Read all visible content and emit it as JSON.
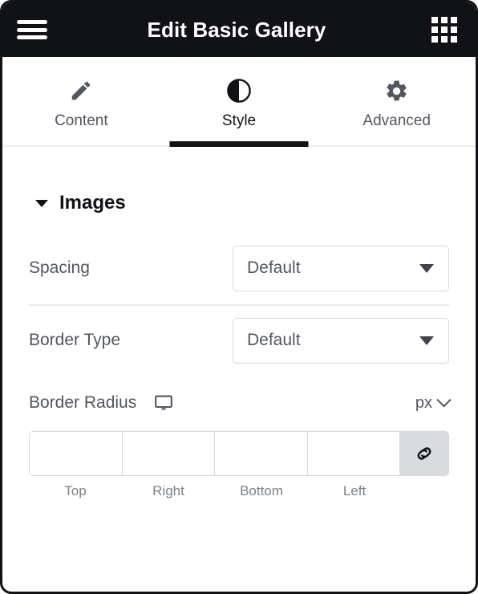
{
  "header": {
    "title": "Edit Basic Gallery",
    "menu_icon": "hamburger-menu-icon",
    "apps_icon": "grid-apps-icon"
  },
  "tabs": [
    {
      "label": "Content",
      "icon": "pencil-icon",
      "active": false
    },
    {
      "label": "Style",
      "icon": "contrast-circle-icon",
      "active": true
    },
    {
      "label": "Advanced",
      "icon": "gear-icon",
      "active": false
    }
  ],
  "section": {
    "title": "Images",
    "expanded": true,
    "toggle_icon": "caret-down-icon"
  },
  "controls": {
    "spacing": {
      "label": "Spacing",
      "value": "Default",
      "dropdown_icon": "chevron-down-icon"
    },
    "border_type": {
      "label": "Border Type",
      "value": "Default",
      "dropdown_icon": "chevron-down-icon"
    },
    "border_radius": {
      "label": "Border Radius",
      "device_icon": "desktop-monitor-icon",
      "unit": "px",
      "unit_icon": "chevron-down-icon",
      "link_icon": "link-chain-icon",
      "fields": [
        {
          "label": "Top",
          "value": ""
        },
        {
          "label": "Right",
          "value": ""
        },
        {
          "label": "Bottom",
          "value": ""
        },
        {
          "label": "Left",
          "value": ""
        }
      ]
    }
  },
  "colors": {
    "header_bg": "#111216",
    "accent": "#111216",
    "label_text": "#52565e",
    "border": "#d5d8dc",
    "link_btn_bg": "#d9dbde"
  }
}
